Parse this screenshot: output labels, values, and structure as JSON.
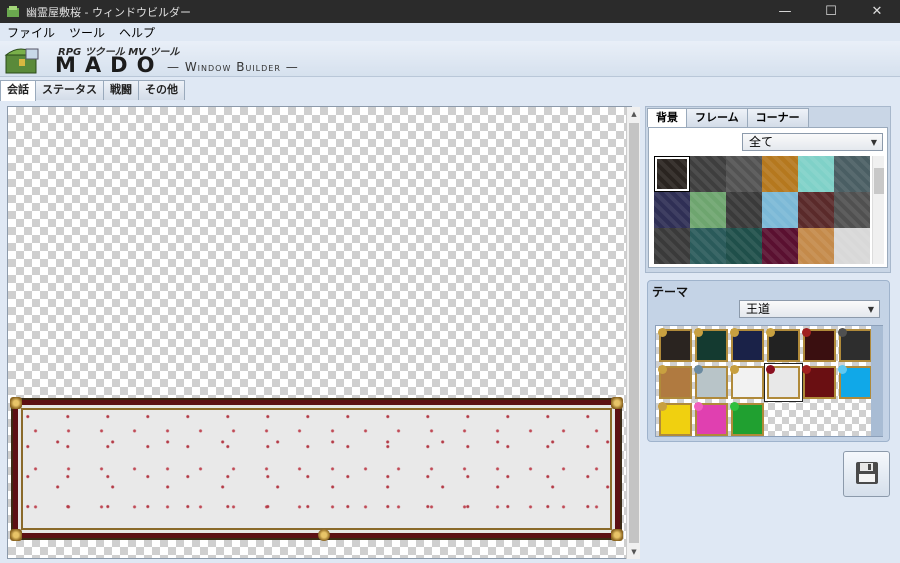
{
  "window": {
    "title": "幽霊屋敷桜 - ウィンドウビルダー",
    "minimize": "—",
    "maximize": "☐",
    "close": "✕"
  },
  "menu": {
    "items": [
      "ファイル",
      "ツール",
      "ヘルプ"
    ]
  },
  "header": {
    "subtitle": "RPG ツクール MV ツール",
    "brand": "MADO",
    "brand_sub": "— Window Builder —"
  },
  "tabs": [
    {
      "label": "会話",
      "active": true
    },
    {
      "label": "ステータス",
      "active": false
    },
    {
      "label": "戦闘",
      "active": false
    },
    {
      "label": "その他",
      "active": false
    }
  ],
  "panel": {
    "tabs": [
      {
        "label": "背景",
        "active": true
      },
      {
        "label": "フレーム",
        "active": false
      },
      {
        "label": "コーナー",
        "active": false
      }
    ],
    "filter_value": "全て",
    "backgrounds": [
      "#2a2420",
      "#3e3e3e",
      "#525252",
      "#b5781e",
      "#7fd1c8",
      "#4a5e63",
      "#2f2f55",
      "#6ea56f",
      "#3a3a3a",
      "#7bb8d6",
      "#5a2a2a",
      "#505050",
      "#3a3a3a",
      "#2a5a5a",
      "#1f4f4a",
      "#5a1030",
      "#c48a4a",
      "#d8d8d8"
    ],
    "selected_background": 0
  },
  "theme": {
    "label": "テーマ",
    "value": "王道",
    "items": [
      {
        "bg": "#2a2420",
        "gem": "#c8a040"
      },
      {
        "bg": "#143a30",
        "gem": "#c8a040"
      },
      {
        "bg": "#1a2248",
        "gem": "#c8a040"
      },
      {
        "bg": "#222222",
        "gem": "#c8a040"
      },
      {
        "bg": "#3a0f10",
        "gem": "#a02020"
      },
      {
        "bg": "#2e2e2e",
        "gem": "#505050"
      },
      {
        "bg": "#b07a40",
        "gem": "#c8a040"
      },
      {
        "bg": "#b8c4c8",
        "gem": "#6a8aa0"
      },
      {
        "bg": "#f2f2f2",
        "gem": "#c8a040"
      },
      {
        "bg": "#e8e8e8",
        "gem": "#8a1020"
      },
      {
        "bg": "#6a0f12",
        "gem": "#a02020"
      },
      {
        "bg": "#10a8e8",
        "gem": "#60c8f0"
      },
      {
        "bg": "#f0d010",
        "gem": "#c8a040"
      },
      {
        "bg": "#e040b0",
        "gem": "#f060c0"
      },
      {
        "bg": "#20a030",
        "gem": "#30c040"
      }
    ],
    "selected_theme": 9
  },
  "colors": {
    "accent": "#dfe8f4",
    "frame": "#5c0f14"
  }
}
